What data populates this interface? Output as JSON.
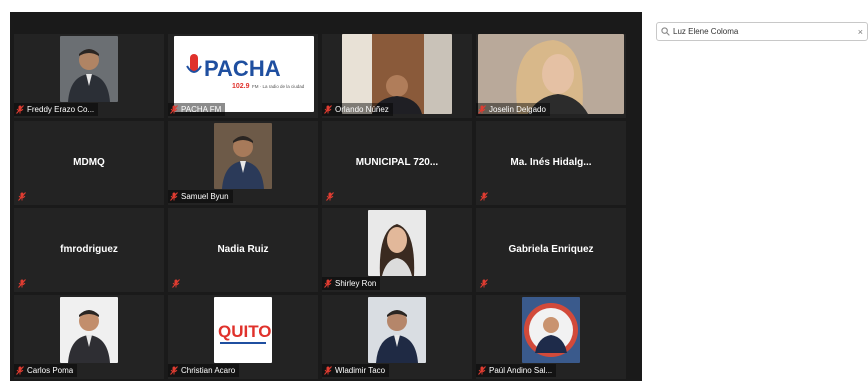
{
  "search": {
    "value": "Luz Elene Coloma",
    "clear_glyph": "×"
  },
  "colors": {
    "gallery_bg": "#1a1a1a",
    "tile_bg": "#232323",
    "muted_mic": "#e03c31",
    "accent": "#2d8cff"
  },
  "participants": [
    {
      "name": "Freddy Erazo Co...",
      "video": "photo",
      "muted": true
    },
    {
      "name": "PACHA FM",
      "video": "logo-pacha",
      "muted": true
    },
    {
      "name": "Orlando Núñez",
      "video": "camera",
      "muted": true
    },
    {
      "name": "Joselin Delgado",
      "video": "camera",
      "muted": true
    },
    {
      "name": "MDMQ",
      "video": "none",
      "muted": true
    },
    {
      "name": "Samuel Byun",
      "video": "photo",
      "muted": true
    },
    {
      "name": "MUNICIPAL 720...",
      "video": "none",
      "muted": true
    },
    {
      "name": "Ma. Inés Hidalg...",
      "video": "none",
      "muted": true
    },
    {
      "name": "fmrodriguez",
      "video": "none",
      "muted": true
    },
    {
      "name": "Nadia Ruiz",
      "video": "none",
      "muted": true
    },
    {
      "name": "Shirley Ron",
      "video": "photo",
      "muted": true
    },
    {
      "name": "Gabriela Enriquez",
      "video": "none",
      "muted": true
    },
    {
      "name": "Carlos Poma",
      "video": "photo",
      "muted": true
    },
    {
      "name": "Christian Acaro",
      "video": "logo-quito",
      "muted": true
    },
    {
      "name": "Wladimir Taco",
      "video": "photo",
      "muted": true
    },
    {
      "name": "Paúl Andino Sal...",
      "video": "photo",
      "muted": true
    }
  ],
  "logos": {
    "pacha_word": "PACHA",
    "pacha_freq": "102.9",
    "pacha_tag": "FM · La radio de la ciudad",
    "quito_word": "QUITO"
  }
}
